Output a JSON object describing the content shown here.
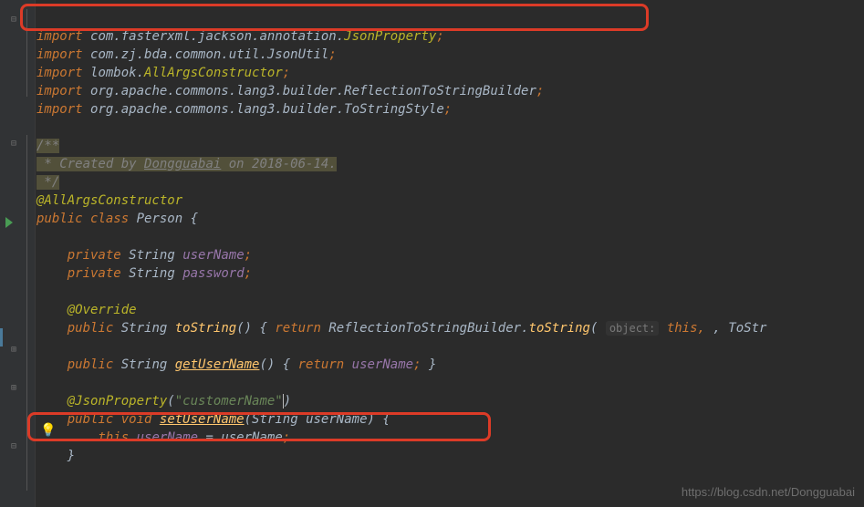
{
  "imports": {
    "l1": "import",
    "l1b": "com.fasterxml.jackson.annotation.",
    "l1c": "JsonProperty",
    "l2": "import",
    "l2b": "com.zj.bda.common.util.JsonUtil",
    "l3": "import",
    "l3b": "lombok.",
    "l3c": "AllArgsConstructor",
    "l4": "import",
    "l4b": "org.apache.commons.lang3.builder.",
    "l4c": "ReflectionToStringBuilder",
    "l5": "import",
    "l5b": "org.apache.commons.lang3.builder.",
    "l5c": "ToStringStyle"
  },
  "comment": {
    "open": "/**",
    "line": " * Created by ",
    "author": "Dongguabai",
    "date": " on 2018-06-14.",
    "close": " */"
  },
  "cls": {
    "ann": "@AllArgsConstructor",
    "decl1": "public class",
    "name": "Person",
    "brace": "{"
  },
  "fields": {
    "kw": "private",
    "type": "String",
    "f1": "userName",
    "f2": "password"
  },
  "override": "@Override",
  "tostring": {
    "pub": "public",
    "type": "String",
    "name": "toString",
    "ret": "return",
    "call": "ReflectionToStringBuilder",
    "method": "toString",
    "hint": "object:",
    "this": "this",
    "tail": ", ToStr"
  },
  "getter": {
    "pub": "public",
    "type": "String",
    "name": "getUserName",
    "ret": "return",
    "field": "userName"
  },
  "jsonprop": {
    "ann": "@JsonProperty",
    "val": "\"customerName\""
  },
  "setter": {
    "pub": "public",
    "void": "void",
    "name": "setUserName",
    "ptype": "String",
    "pname": "userName",
    "this": "this",
    "field": "userName",
    "assign": " = userName"
  },
  "watermark": "https://blog.csdn.net/Dongguabai"
}
